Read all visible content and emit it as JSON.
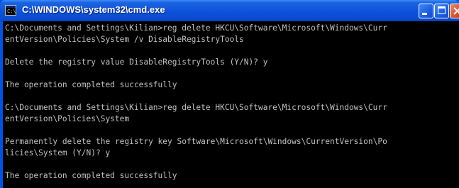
{
  "window": {
    "title": "C:\\WINDOWS\\system32\\cmd.exe",
    "icon": "cmd-icon",
    "controls": [
      "minimize-icon",
      "maximize-icon",
      "close-icon"
    ]
  },
  "console": {
    "text_color": "#c0c0c0",
    "background_color": "#000000",
    "lines": [
      "C:\\Documents and Settings\\Kilian>reg delete HKCU\\Software\\Microsoft\\Windows\\Curr",
      "entVersion\\Policies\\System /v DisableRegistryTools",
      "",
      "Delete the registry value DisableRegistryTools (Y/N)? y",
      "",
      "The operation completed successfully",
      "",
      "C:\\Documents and Settings\\Kilian>reg delete HKCU\\Software\\Microsoft\\Windows\\Curr",
      "entVersion\\Policies\\System",
      "",
      "Permanently delete the registry key Software\\Microsoft\\Windows\\CurrentVersion\\Po",
      "licies\\System (Y/N)? y",
      "",
      "The operation completed successfully"
    ]
  },
  "colors": {
    "titlebar": "#0a4fd6",
    "close_button": "#d8542d"
  }
}
